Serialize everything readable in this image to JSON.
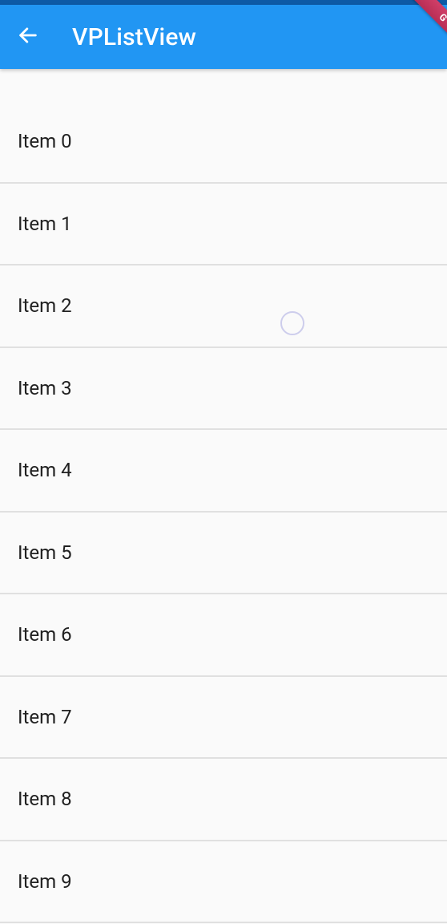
{
  "header": {
    "title": "VPListView"
  },
  "list": {
    "items": [
      {
        "label": "Item 0"
      },
      {
        "label": "Item 1"
      },
      {
        "label": "Item 2"
      },
      {
        "label": "Item 3"
      },
      {
        "label": "Item 4"
      },
      {
        "label": "Item 5"
      },
      {
        "label": "Item 6"
      },
      {
        "label": "Item 7"
      },
      {
        "label": "Item 8"
      },
      {
        "label": "Item 9"
      }
    ]
  },
  "banner": {
    "label": "G"
  }
}
